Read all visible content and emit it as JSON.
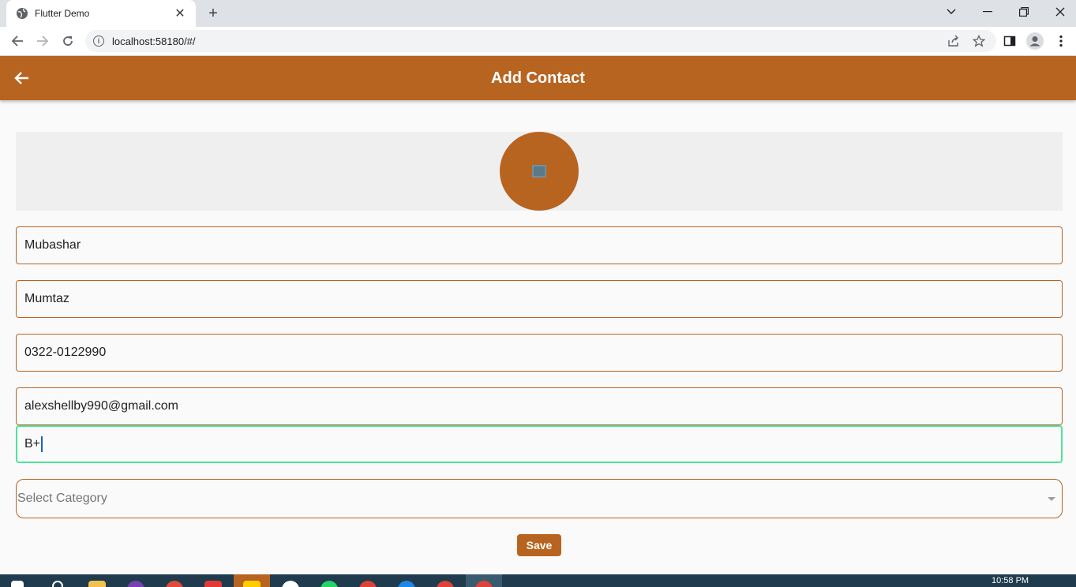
{
  "browser": {
    "tab_title": "Flutter Demo",
    "tab_close": "✕",
    "new_tab": "+",
    "url": "localhost:58180/#/",
    "info_glyph": "i"
  },
  "appbar": {
    "title": "Add Contact"
  },
  "form": {
    "first_name": "Mubashar",
    "last_name": "Mumtaz",
    "phone": "0322-0122990",
    "email": "alexshellby990@gmail.com",
    "blood_group": "B+",
    "category_placeholder": "Select Category",
    "save_label": "Save"
  },
  "taskbar": {
    "time": "10:58 PM"
  },
  "colors": {
    "primary": "#b86421",
    "focus": "#4ee39a"
  }
}
